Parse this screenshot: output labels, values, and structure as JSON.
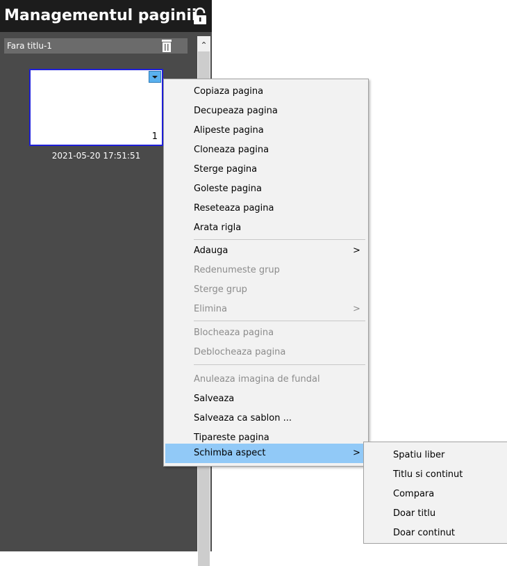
{
  "panel": {
    "title": "Managementul paginii",
    "group_name": "Fara titlu-1",
    "page_number": "1",
    "page_timestamp": "2021-05-20 17:51:51"
  },
  "context_menu": {
    "items": [
      {
        "label": "Copiaza pagina",
        "enabled": true
      },
      {
        "label": "Decupeaza pagina",
        "enabled": true
      },
      {
        "label": "Alipeste pagina",
        "enabled": true
      },
      {
        "label": "Cloneaza pagina",
        "enabled": true
      },
      {
        "label": "Sterge pagina",
        "enabled": true
      },
      {
        "label": "Goleste pagina",
        "enabled": true
      },
      {
        "label": "Reseteaza pagina",
        "enabled": true
      },
      {
        "label": "Arata rigla",
        "enabled": true
      },
      {
        "label": "Adauga",
        "enabled": true,
        "submenu_arrow": ">"
      },
      {
        "label": "Redenumeste grup",
        "enabled": false
      },
      {
        "label": "Sterge grup",
        "enabled": false
      },
      {
        "label": "Elimina",
        "enabled": false,
        "submenu_arrow": ">"
      },
      {
        "label": "Blocheaza pagina",
        "enabled": false
      },
      {
        "label": "Deblocheaza pagina",
        "enabled": false
      },
      {
        "label": "Anuleaza imagina de fundal",
        "enabled": false
      },
      {
        "label": "Salveaza",
        "enabled": true
      },
      {
        "label": "Salveaza ca sablon ...",
        "enabled": true
      },
      {
        "label": "Tipareste pagina",
        "enabled": true
      },
      {
        "label": "Schimba aspect",
        "enabled": true,
        "highlighted": true,
        "submenu_arrow": ">"
      }
    ]
  },
  "submenu": {
    "items": [
      "Spatiu liber",
      "Titlu si continut",
      "Compara",
      "Doar titlu",
      "Doar continut"
    ]
  },
  "colors": {
    "highlight": "#91c9f7",
    "page_border": "#1f1fd8",
    "panel_bg": "#4a4a4a"
  }
}
